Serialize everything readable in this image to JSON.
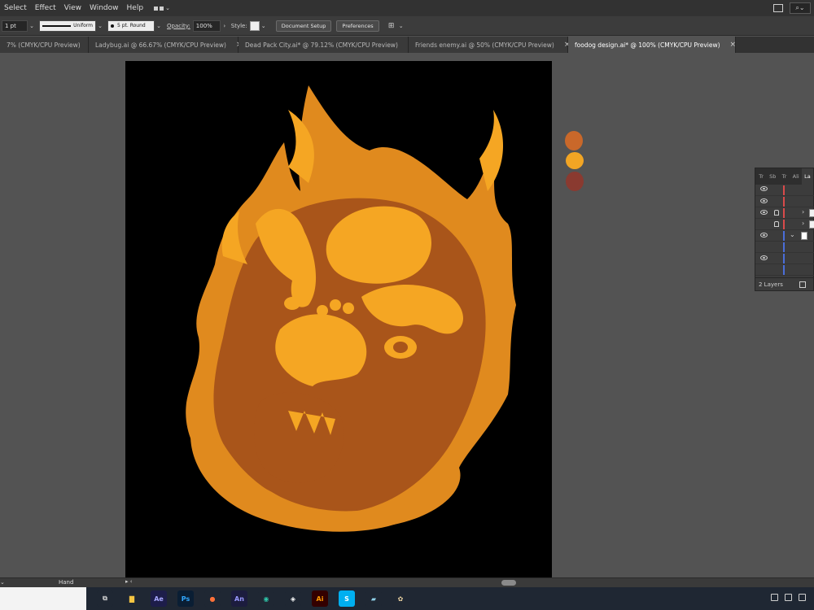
{
  "menu": {
    "items": [
      "Select",
      "Effect",
      "View",
      "Window",
      "Help"
    ],
    "search_icon": "search-icon"
  },
  "control_bar": {
    "stroke_weight": "1 pt",
    "stroke_profile": "Uniform",
    "brush": "5 pt. Round",
    "opacity_label": "Opacity:",
    "opacity_value": "100%",
    "style_label": "Style:",
    "document_setup": "Document Setup",
    "preferences": "Preferences"
  },
  "tabs": [
    {
      "label": "7% (CMYK/CPU Preview)",
      "active": false
    },
    {
      "label": "Ladybug.ai @ 66.67% (CMYK/CPU Preview)",
      "active": false
    },
    {
      "label": "Dead Pack City.ai* @ 79.12% (CMYK/CPU Preview)",
      "active": false
    },
    {
      "label": "Friends enemy.ai @ 50% (CMYK/CPU Preview)",
      "active": false
    },
    {
      "label": "foodog design.ai* @ 100% (CMYK/CPU Preview)",
      "active": true
    }
  ],
  "tab_close": "×",
  "swatches": [
    "#c9682a",
    "#f2a524",
    "#8a3a30"
  ],
  "artwork_colors": {
    "background": "#000000",
    "light": "#f5a623",
    "mid": "#e08a1e",
    "dark": "#a9551a"
  },
  "layers_panel": {
    "tabs": [
      "Tr",
      "Sb",
      "Tr",
      "Ali",
      "La"
    ],
    "footer": "2 Layers",
    "layer_colors": [
      "#d94a4a",
      "#4a6ed9"
    ]
  },
  "status_bar": {
    "tool": "Hand"
  },
  "taskbar": {
    "apps": [
      {
        "name": "task-view-icon",
        "glyph": "⧉",
        "bg": "#1f2733",
        "fg": "#cfcfcf"
      },
      {
        "name": "file-explorer-icon",
        "glyph": "▇",
        "bg": "#1f2733",
        "fg": "#f5c542"
      },
      {
        "name": "after-effects-icon",
        "glyph": "Ae",
        "bg": "#1d1d4a",
        "fg": "#a8a8ff"
      },
      {
        "name": "photoshop-icon",
        "glyph": "Ps",
        "bg": "#0a1e34",
        "fg": "#31a8ff"
      },
      {
        "name": "firefox-icon",
        "glyph": "●",
        "bg": "#1f2733",
        "fg": "#ff7139"
      },
      {
        "name": "animate-icon",
        "glyph": "An",
        "bg": "#1c1c3e",
        "fg": "#9999ff"
      },
      {
        "name": "edge-icon",
        "glyph": "◉",
        "bg": "#1f2733",
        "fg": "#2fc4a8"
      },
      {
        "name": "capcut-icon",
        "glyph": "◈",
        "bg": "#1f2733",
        "fg": "#ffffff"
      },
      {
        "name": "illustrator-icon",
        "glyph": "Ai",
        "bg": "#330000",
        "fg": "#ff9a00",
        "active": true
      },
      {
        "name": "skype-icon",
        "glyph": "S",
        "bg": "#00aff0",
        "fg": "#ffffff"
      },
      {
        "name": "notes-icon",
        "glyph": "▰",
        "bg": "#1f2733",
        "fg": "#8fd0e8"
      },
      {
        "name": "paint-icon",
        "glyph": "✿",
        "bg": "#1f2733",
        "fg": "#e8d0a0"
      }
    ]
  }
}
